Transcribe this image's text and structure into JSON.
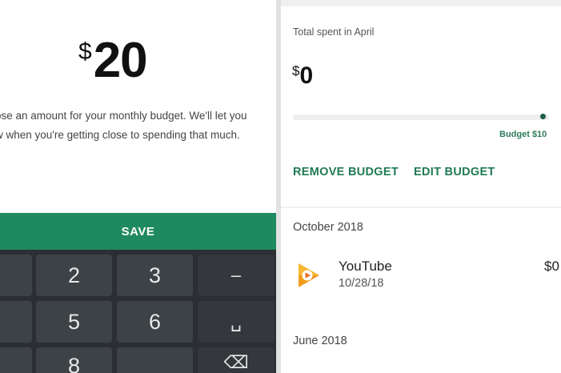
{
  "left_pane": {
    "currency_symbol": "$",
    "amount": "20",
    "description_line1": "ose an amount for your monthly budget. We'll let you",
    "description_line2": "w when you're getting close to spending that much.",
    "save_label": "SAVE",
    "keyboard": {
      "row1": [
        "2",
        "3",
        "–"
      ],
      "row2": [
        "5",
        "6",
        "␣"
      ],
      "row3": [
        "8",
        "⌫"
      ]
    }
  },
  "right_pane": {
    "spent_label": "Total spent in April",
    "spent_currency": "$",
    "spent_amount": "0",
    "budget_label": "Budget $10",
    "budget_progress": 0,
    "remove_budget_label": "REMOVE BUDGET",
    "edit_budget_label": "EDIT BUDGET",
    "sections": [
      {
        "title": "October 2018",
        "transactions": [
          {
            "name": "YouTube",
            "date": "10/28/18",
            "amount": "$0",
            "icon": "google-play-icon"
          }
        ]
      },
      {
        "title": "June 2018"
      }
    ]
  },
  "colors": {
    "accent_green": "#1f8a5d",
    "link_green": "#1f7a55",
    "keyboard_bg": "#2b2f33",
    "key_bg": "#3d4246"
  }
}
